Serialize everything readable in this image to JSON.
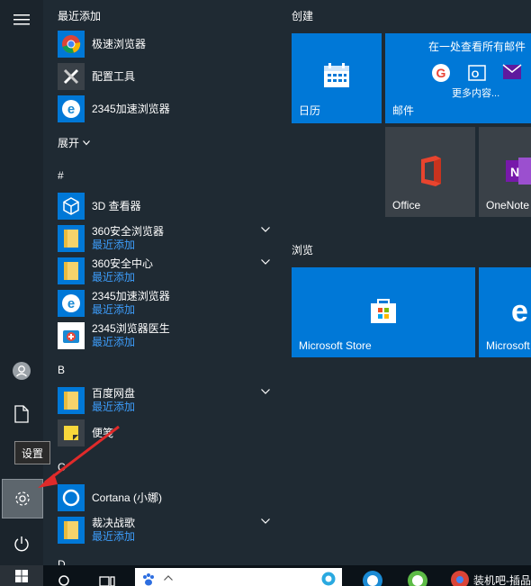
{
  "rail": {
    "tooltip": "设置"
  },
  "list": {
    "recent_header": "最近添加",
    "recent": [
      {
        "name": "极速浏览器"
      },
      {
        "name": "配置工具"
      },
      {
        "name": "2345加速浏览器"
      }
    ],
    "expand_label": "展开",
    "hash_header": "#",
    "hash_items": [
      {
        "name": "3D 查看器",
        "sub": ""
      },
      {
        "name": "360安全浏览器",
        "sub": "最近添加"
      },
      {
        "name": "360安全中心",
        "sub": "最近添加"
      },
      {
        "name": "2345加速浏览器",
        "sub": "最近添加"
      },
      {
        "name": "2345浏览器医生",
        "sub": "最近添加"
      }
    ],
    "b_header": "B",
    "b_items": [
      {
        "name": "百度网盘",
        "sub": "最近添加"
      },
      {
        "name": "便笺",
        "sub": ""
      }
    ],
    "c_header": "C",
    "c_items": [
      {
        "name": "Cortana (小娜)",
        "sub": ""
      },
      {
        "name": "裁决战歌",
        "sub": "最近添加"
      }
    ],
    "d_header": "D"
  },
  "tiles": {
    "create_header": "创建",
    "browse_header": "浏览",
    "calendar_label": "日历",
    "mail_label": "邮件",
    "mail_title": "在一处查看所有邮件",
    "mail_more": "更多内容...",
    "office_label": "Office",
    "onenote_label": "OneNote",
    "store_label": "Microsoft Store",
    "edge_label": "Microsoft"
  },
  "taskbar": {
    "app_label": "装机吧-插品"
  },
  "colors": {
    "tile_blue": "#0078d7",
    "tile_gray": "#3a4148",
    "recent_blue": "#3d9dfb",
    "arrow_red": "#e02a2a"
  }
}
